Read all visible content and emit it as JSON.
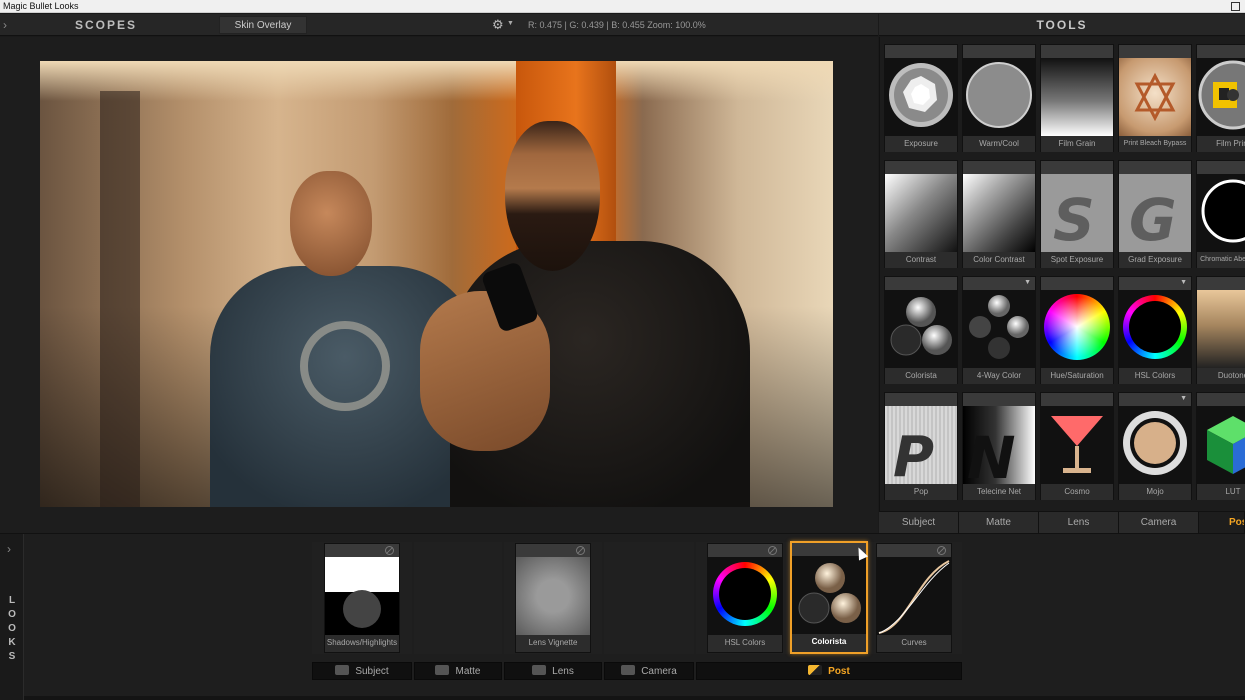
{
  "window": {
    "title": "Magic Bullet Looks"
  },
  "viewer": {
    "scopes_label": "SCOPES",
    "skin_overlay_label": "Skin Overlay",
    "readout": "R: 0.475 | G: 0.439 | B: 0.455   Zoom: 100.0%"
  },
  "tools": {
    "title": "TOOLS",
    "items": [
      {
        "label": "Exposure"
      },
      {
        "label": "Warm/Cool"
      },
      {
        "label": "Film Grain"
      },
      {
        "label": "Print Bleach Bypass"
      },
      {
        "label": "Film Print"
      },
      {
        "label": "Contrast"
      },
      {
        "label": "Color Contrast"
      },
      {
        "label": "Spot Exposure"
      },
      {
        "label": "Grad Exposure"
      },
      {
        "label": "Chromatic Aberration"
      },
      {
        "label": "Colorista"
      },
      {
        "label": "4-Way Color"
      },
      {
        "label": "Hue/Saturation"
      },
      {
        "label": "HSL Colors"
      },
      {
        "label": "Duotone"
      },
      {
        "label": "Pop"
      },
      {
        "label": "Telecine Net"
      },
      {
        "label": "Cosmo"
      },
      {
        "label": "Mojo"
      },
      {
        "label": "LUT"
      }
    ],
    "tabs": [
      {
        "label": "Subject"
      },
      {
        "label": "Matte"
      },
      {
        "label": "Lens"
      },
      {
        "label": "Camera"
      },
      {
        "label": "Post"
      }
    ],
    "active_tab": "Post"
  },
  "looks": {
    "side_label": [
      "L",
      "O",
      "O",
      "K",
      "S"
    ],
    "tiles": [
      {
        "label": "Shadows/Highlights"
      },
      {
        "label": "Lens Vignette"
      },
      {
        "label": "HSL Colors"
      },
      {
        "label": "Colorista"
      },
      {
        "label": "Curves"
      }
    ],
    "selected_tile": "Colorista",
    "categories": [
      {
        "label": "Subject"
      },
      {
        "label": "Matte"
      },
      {
        "label": "Lens"
      },
      {
        "label": "Camera"
      },
      {
        "label": "Post"
      }
    ],
    "active_category": "Post"
  },
  "colors": {
    "accent": "#f5a623",
    "selection_border": "#f0a028",
    "panel_bg": "#1e1e1e"
  }
}
